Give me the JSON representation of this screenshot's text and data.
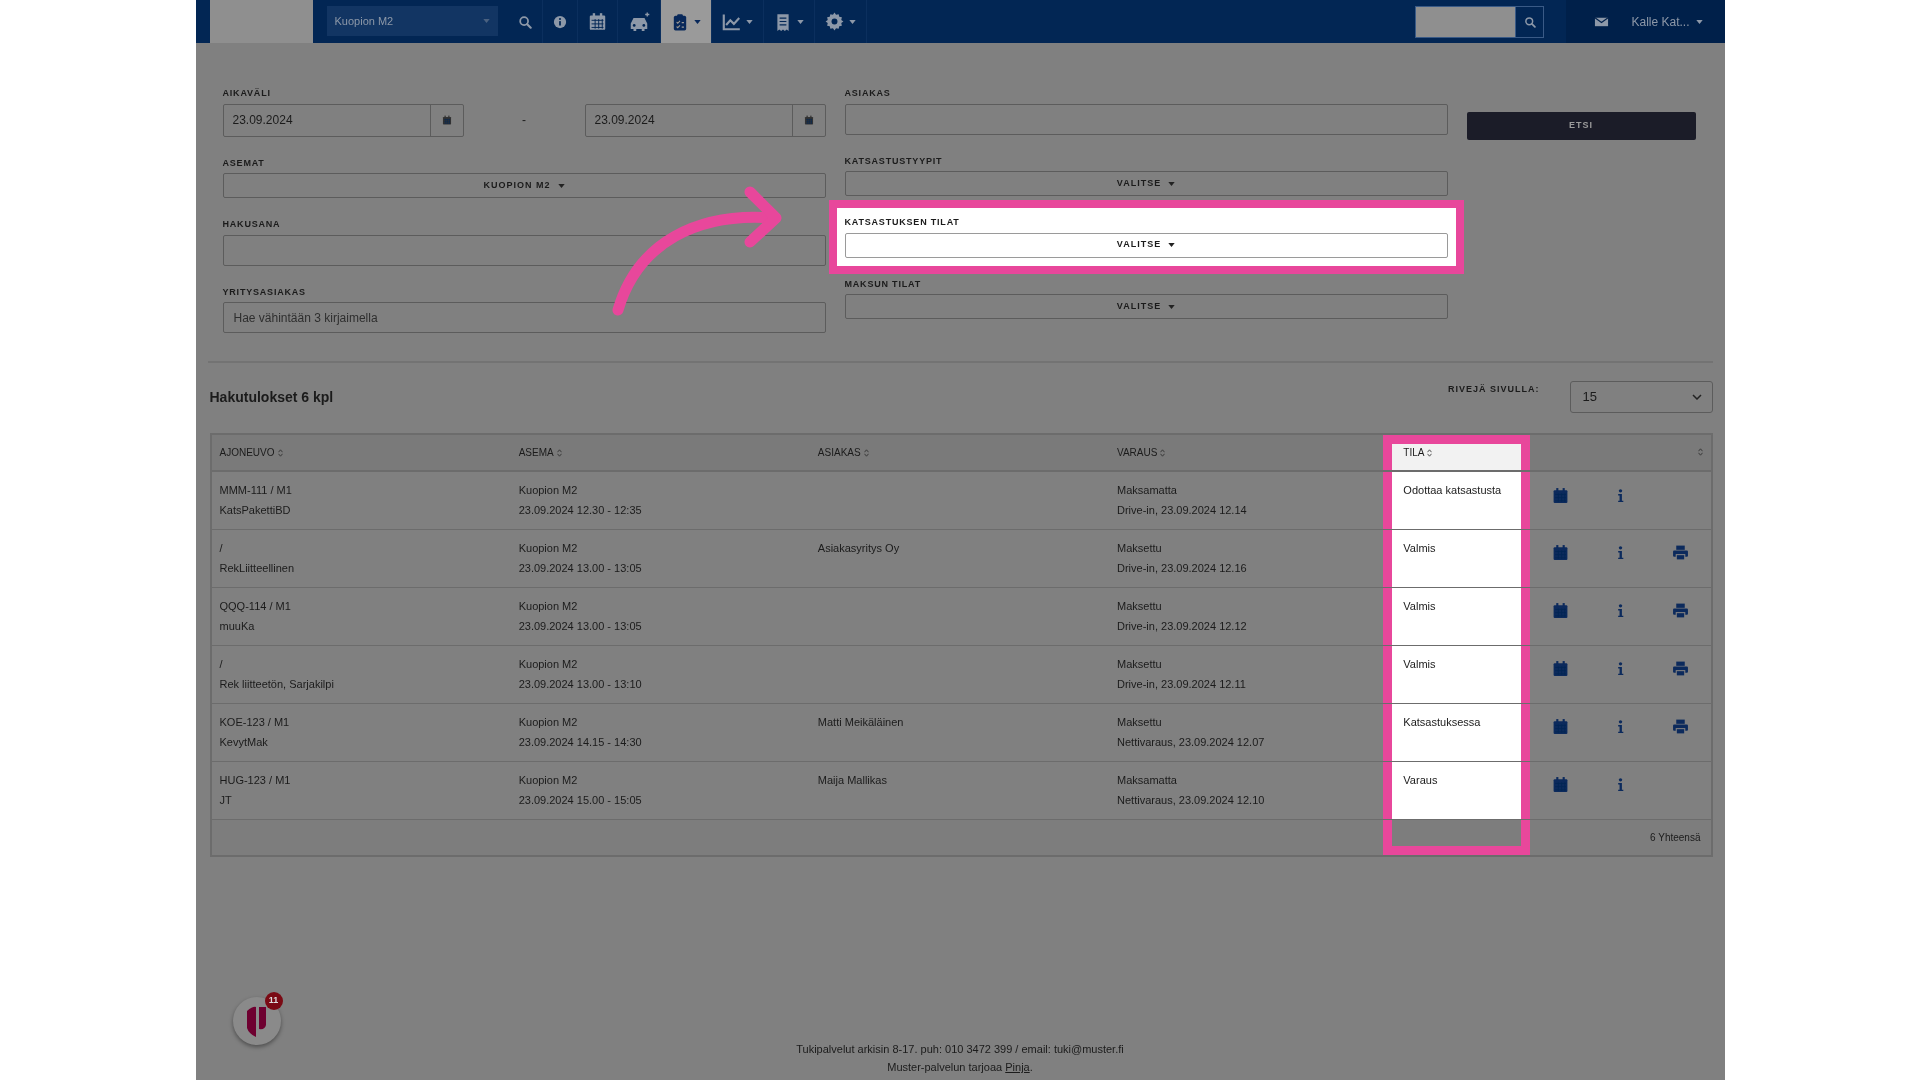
{
  "navbar": {
    "station_select": {
      "value": "Kuopion M2"
    },
    "menu": [
      {
        "kind": "search",
        "selected": false,
        "dropdown": false
      },
      {
        "kind": "info",
        "selected": false,
        "dropdown": false
      },
      {
        "kind": "calendar",
        "selected": false,
        "dropdown": false
      },
      {
        "kind": "car",
        "selected": false,
        "dropdown": false
      },
      {
        "kind": "clipboard",
        "selected": true,
        "dropdown": true
      },
      {
        "kind": "chart",
        "selected": false,
        "dropdown": true
      },
      {
        "kind": "receipt",
        "selected": false,
        "dropdown": true
      },
      {
        "kind": "gear",
        "selected": false,
        "dropdown": true
      }
    ],
    "user": "Kalle Kat..."
  },
  "filters_left": [
    {
      "kind": "dates",
      "label": "AIKAVÄLI",
      "from": "23.09.2024",
      "separator": "-",
      "to": "23.09.2024",
      "highlighted": false
    },
    {
      "kind": "dropdown",
      "label": "ASEMAT",
      "value": "KUOPION M2",
      "highlighted": false
    },
    {
      "kind": "text",
      "label": "HAKUSANA",
      "highlighted": false
    },
    {
      "kind": "text",
      "label": "YRITYSASIAKAS",
      "placeholder": "Hae vähintään 3 kirjaimella",
      "highlighted": false
    }
  ],
  "filters_right": [
    {
      "kind": "text",
      "label": "ASIAKAS",
      "highlighted": false
    },
    {
      "kind": "dropdown",
      "label": "KATSASTUSTYYPIT",
      "value": "VALITSE",
      "highlighted": false
    },
    {
      "kind": "dropdown",
      "label": "KATSASTUKSEN TILAT",
      "value": "VALITSE",
      "highlighted": true
    },
    {
      "kind": "dropdown",
      "label": "MAKSUN TILAT",
      "value": "VALITSE",
      "highlighted": false
    }
  ],
  "search_button": "ETSI",
  "results": {
    "title": "Hakutulokset 6 kpl",
    "rows_per_page": {
      "label": "RIVEJÄ SIVULLA:",
      "value": "15"
    },
    "columns": [
      {
        "label": "AJONEUVO",
        "highlighted": false
      },
      {
        "label": "ASEMA",
        "highlighted": false
      },
      {
        "label": "ASIAKAS",
        "highlighted": false
      },
      {
        "label": "VARAUS",
        "highlighted": false
      },
      {
        "label": "TILA",
        "highlighted": true
      },
      {
        "highlighted": false
      }
    ],
    "rows": [
      {
        "vehicle": [
          "MMM-111 / M1",
          "KatsPakettiBD"
        ],
        "station": [
          "Kuopion M2",
          "23.09.2024 12.30 - 12:35"
        ],
        "booking": [
          "Maksamatta",
          "Drive-in, 23.09.2024 12.14"
        ],
        "status": "Odottaa katsastusta",
        "printable": false
      },
      {
        "vehicle": [
          "/",
          "RekLiitteellinen"
        ],
        "station": [
          "Kuopion M2",
          "23.09.2024 13.00 - 13:05"
        ],
        "customer": "Asiakasyritys Oy",
        "booking": [
          "Maksettu",
          "Drive-in, 23.09.2024 12.16"
        ],
        "status": "Valmis",
        "printable": true
      },
      {
        "vehicle": [
          "QQQ-114 / M1",
          "muuKa"
        ],
        "station": [
          "Kuopion M2",
          "23.09.2024 13.00 - 13:05"
        ],
        "booking": [
          "Maksettu",
          "Drive-in, 23.09.2024 12.12"
        ],
        "status": "Valmis",
        "printable": true
      },
      {
        "vehicle": [
          "/",
          "Rek liitteetön, Sarjakilpi"
        ],
        "station": [
          "Kuopion M2",
          "23.09.2024 13.00 - 13:10"
        ],
        "booking": [
          "Maksettu",
          "Drive-in, 23.09.2024 12.11"
        ],
        "status": "Valmis",
        "printable": true
      },
      {
        "vehicle": [
          "KOE-123 / M1",
          "KevytMak"
        ],
        "station": [
          "Kuopion M2",
          "23.09.2024 14.15 - 14:30"
        ],
        "customer": "Matti Meikäläinen",
        "booking": [
          "Maksettu",
          "Nettivaraus, 23.09.2024 12.07"
        ],
        "status": "Katsastuksessa",
        "printable": true
      },
      {
        "vehicle": [
          "HUG-123 / M1",
          "JT"
        ],
        "station": [
          "Kuopion M2",
          "23.09.2024 15.00 - 15:05"
        ],
        "customer": "Maija Mallikas",
        "booking": [
          "Maksamatta",
          "Nettivaraus, 23.09.2024 12.10"
        ],
        "status": "Varaus",
        "printable": false
      }
    ],
    "total": "6 Yhteensä"
  },
  "chat": {
    "badge": "11"
  },
  "footer": {
    "support": "Tukipalvelut arkisin 8-17. puh: 010 3472 399 / email: tuki@muster.fi",
    "provider_before": "Muster-palvelun tarjoaa ",
    "provider_link": "Pinja",
    "provider_after": "."
  }
}
